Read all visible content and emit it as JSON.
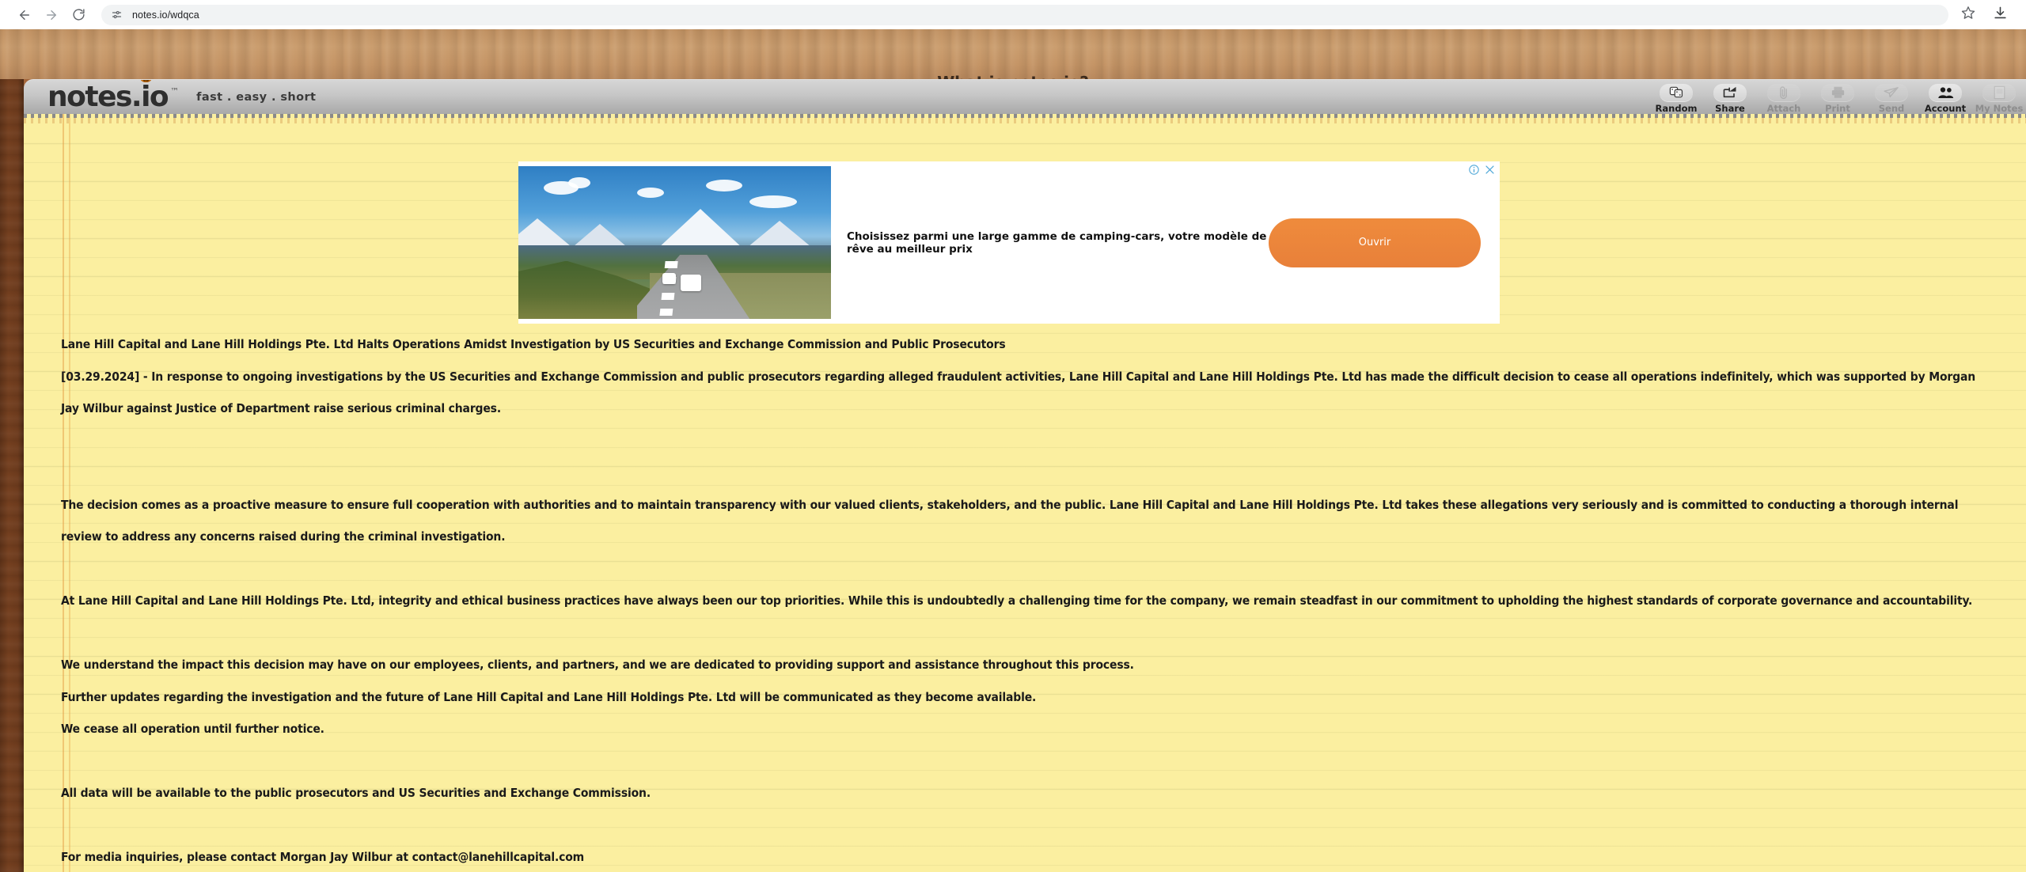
{
  "browser": {
    "back_icon": "back-arrow-icon",
    "forward_icon": "forward-arrow-icon",
    "reload_icon": "reload-icon",
    "site_info_icon": "site-settings-icon",
    "url": "notes.io/wdqca",
    "bookmark_icon": "star-icon",
    "download_icon": "download-icon"
  },
  "site": {
    "title_link": "What is notes.io?",
    "logo_text": "notes.io",
    "logo_tm": "™",
    "tagline": "fast . easy . short"
  },
  "toolbar": {
    "buttons": [
      {
        "label": "Random",
        "icon": "dice-icon",
        "disabled": false
      },
      {
        "label": "Share",
        "icon": "share-arrow-icon",
        "disabled": false
      },
      {
        "label": "Attach",
        "icon": "paperclip-icon",
        "disabled": true
      },
      {
        "label": "Print",
        "icon": "printer-icon",
        "disabled": true
      },
      {
        "label": "Send",
        "icon": "paper-plane-icon",
        "disabled": true
      },
      {
        "label": "Account",
        "icon": "people-icon",
        "disabled": false
      },
      {
        "label": "My Notes",
        "icon": "notes-page-icon",
        "disabled": true
      }
    ]
  },
  "ad": {
    "headline": "Choisissez parmi une large gamme de camping-cars, votre modèle de rêve au meilleur prix",
    "cta_label": "Ouvrir",
    "info_icon": "ad-info-icon",
    "close_icon": "ad-close-icon",
    "image_alt": "camper-vans-on-mountain-road"
  },
  "note": {
    "paragraphs": [
      {
        "id": "headline",
        "text": "Lane Hill Capital and Lane Hill Holdings Pte. Ltd Halts Operations Amidst Investigation by US Securities and Exchange Commission and Public Prosecutors",
        "spacing": "none"
      },
      {
        "id": "lede",
        "text": "[03.29.2024] - In response to ongoing investigations by the US Securities and Exchange Commission and public prosecutors regarding alleged fraudulent activities, Lane Hill Capital and Lane Hill Holdings Pte. Ltd has made the difficult decision to cease all operations indefinitely, which was supported by Morgan Jay Wilbur against Justice of Department raise serious criminal charges.",
        "spacing": "none"
      },
      {
        "id": "decision",
        "text": "The decision comes as a proactive measure to ensure full cooperation with authorities and to maintain transparency with our valued clients, stakeholders, and the public. Lane Hill Capital and Lane Hill Holdings Pte. Ltd takes these allegations very seriously and is committed to conducting a thorough internal review to address any concerns raised during the criminal investigation.",
        "spacing": "double"
      },
      {
        "id": "integrity",
        "text": "At Lane Hill Capital and Lane Hill Holdings Pte. Ltd, integrity and ethical business practices have always been our top priorities. While this is undoubtedly a challenging time for the company, we remain steadfast in our commitment to upholding the highest standards of corporate governance and accountability.",
        "spacing": "single"
      },
      {
        "id": "impact",
        "text": "We understand the impact this decision may have on our employees, clients, and partners, and we are dedicated to providing support and assistance throughout this process.",
        "spacing": "single"
      },
      {
        "id": "updates",
        "text": "Further updates regarding the investigation and the future of Lane Hill Capital and Lane Hill Holdings Pte. Ltd will be communicated as they become available.",
        "spacing": "none"
      },
      {
        "id": "cease",
        "text": "We cease all operation until further notice.",
        "spacing": "none"
      },
      {
        "id": "data",
        "text": "All data will be available to the public prosecutors and US Securities and Exchange Commission.",
        "spacing": "single"
      },
      {
        "id": "media",
        "text": "For media inquiries, please contact Morgan Jay Wilbur at contact@lanehillcapital.com",
        "spacing": "single"
      }
    ]
  },
  "colors": {
    "notepad_yellow": "#fbefa0",
    "wood_dark": "#6d3b1d",
    "wood_light": "#c59566",
    "header_gray": "#c6c6c6",
    "ad_orange": "#e8803a",
    "ad_control_blue": "#4fa8d8"
  }
}
